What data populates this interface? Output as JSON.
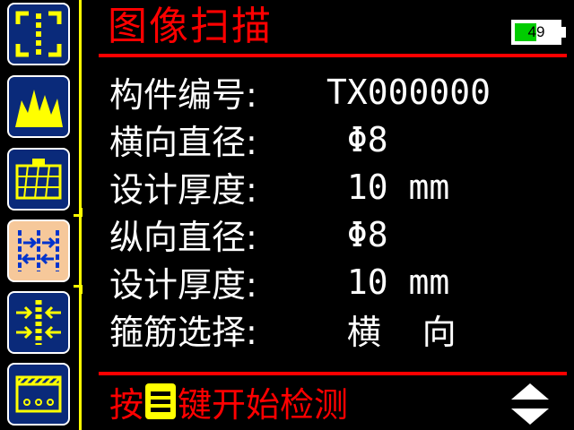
{
  "header": {
    "title": "图像扫描",
    "battery": {
      "level_text": "49",
      "level_percent": 49,
      "fill_color": "#00cc00"
    }
  },
  "sidebar": {
    "items": [
      {
        "icon": "scan-frame-icon",
        "active": false
      },
      {
        "icon": "mountain-wave-icon",
        "active": false
      },
      {
        "icon": "grid-mesh-icon",
        "active": false
      },
      {
        "icon": "rebar-spacing-icon",
        "active": true
      },
      {
        "icon": "compress-bar-icon",
        "active": false
      },
      {
        "icon": "slab-cover-icon",
        "active": false
      }
    ]
  },
  "params": [
    {
      "label": "构件编号:",
      "value": "TX000000"
    },
    {
      "label": "横向直径:",
      "value": " Φ8"
    },
    {
      "label": "设计厚度:",
      "value": " 10 mm"
    },
    {
      "label": "纵向直径:",
      "value": " Φ8"
    },
    {
      "label": "设计厚度:",
      "value": " 10 mm"
    },
    {
      "label": "箍筋选择:",
      "value": " 横  向"
    }
  ],
  "footer": {
    "prefix": "按",
    "suffix": "键开始检测"
  },
  "colors": {
    "title": "#ff0000",
    "accent_line": "#ffff00",
    "sidebar_bg": "#0a2a7a",
    "sidebar_active_bg": "#f6c89a"
  }
}
